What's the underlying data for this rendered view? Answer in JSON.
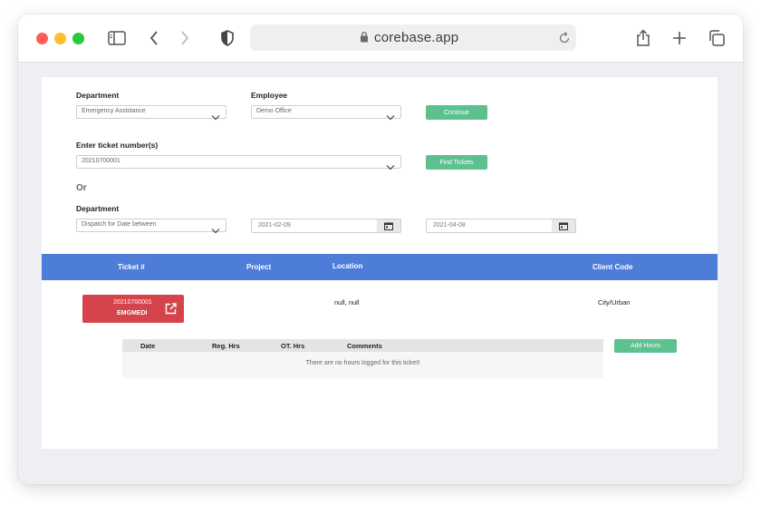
{
  "browser": {
    "url": "corebase.app"
  },
  "form": {
    "department_label": "Department",
    "department_value": "Emergency Assistance",
    "employee_label": "Employee",
    "employee_value": "Demo Office",
    "continue_label": "Continue",
    "ticket_label": "Enter ticket number(s)",
    "ticket_value": "20210700001",
    "find_tickets_label": "Find Tickets",
    "or_label": "Or",
    "department2_label": "Department",
    "department2_value": "Dispatch for Date between",
    "date_from": "2021-02-09",
    "date_to": "2021-04-08"
  },
  "table": {
    "headers": [
      "Ticket #",
      "Project",
      "Location",
      "Client Code"
    ],
    "rows": [
      {
        "ticket_number": "20210700001",
        "ticket_code": "EMGMEDI",
        "project": "",
        "location": "null, null",
        "client_code": "City/Urban"
      }
    ]
  },
  "hours": {
    "headers": [
      "Date",
      "Reg. Hrs",
      "OT. Hrs",
      "Comments"
    ],
    "empty_message": "There are  no hours logged for this ticket!",
    "add_hours_label": "Add Hours"
  },
  "colors": {
    "accent_blue": "#4e7dd9",
    "green_button": "#5cc08f",
    "ticket_red": "#d5434b"
  },
  "icons": [
    "sidebar-icon",
    "back-icon",
    "forward-icon",
    "shield-icon",
    "lock-icon",
    "reload-icon",
    "share-icon",
    "new-tab-icon",
    "tabs-icon",
    "chevron-down-icon",
    "calendar-icon",
    "external-link-icon"
  ]
}
